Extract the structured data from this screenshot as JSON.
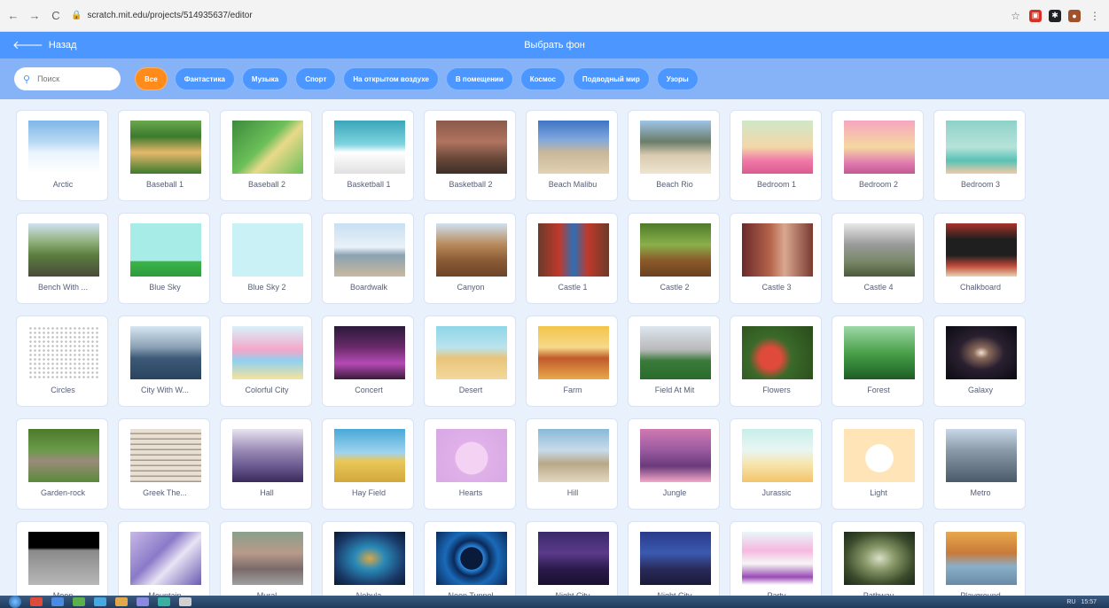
{
  "browser": {
    "url": "scratch.mit.edu/projects/514935637/editor",
    "back_glyph": "←",
    "forward_glyph": "→",
    "reload_glyph": "C",
    "star_glyph": "☆",
    "extensions": [
      {
        "name": "pdf-extension-icon",
        "color": "#d93025",
        "glyph": "▣"
      },
      {
        "name": "puzzle-extension-icon",
        "color": "#202124",
        "glyph": "✱"
      },
      {
        "name": "profile-avatar-icon",
        "color": "#a0522d",
        "glyph": "●"
      }
    ],
    "menu_glyph": "⋮"
  },
  "header": {
    "back_label": "Назад",
    "back_glyph": "🡐",
    "title": "Выбрать фон"
  },
  "filter": {
    "search_placeholder": "Поиск",
    "search_glyph": "⚲",
    "tags": [
      "Все",
      "Фантастика",
      "Музыка",
      "Спорт",
      "На открытом воздухе",
      "В помещении",
      "Космос",
      "Подводный мир",
      "Узоры"
    ],
    "active_tag": 0
  },
  "colors": {
    "accent": "#4c97ff",
    "active_tag": "#ff8c1a",
    "filter_bar": "#86b3f7"
  },
  "backdrops": [
    {
      "label": "Arctic",
      "bg": "linear-gradient(#7fb6e8 0%, #b7d9f3 40%, #e9f4fb 60%, #ffffff 100%)"
    },
    {
      "label": "Baseball 1",
      "bg": "linear-gradient(#6aa84f 0%, #3c7a2d 30%, #e6b86a 60%, #3c7a2d 100%)"
    },
    {
      "label": "Baseball 2",
      "bg": "linear-gradient(135deg, #3c8a3c 0%, #6cbf5a 45%, #e9d98a 60%, #6cbf5a 100%)"
    },
    {
      "label": "Basketball 1",
      "bg": "linear-gradient(#3aa6b9 0%, #7fd4e0 45%, #ffffff 60%, #e0e0e0 100%)"
    },
    {
      "label": "Basketball 2",
      "bg": "linear-gradient(#8b5a4a 0%, #b07360 40%, #6b4a3a 70%, #3d2f28 100%)"
    },
    {
      "label": "Beach Malibu",
      "bg": "linear-gradient(#3f73c4 0%, #7fa7de 35%, #c9b79a 60%, #e2d2b4 100%)"
    },
    {
      "label": "Beach Rio",
      "bg": "linear-gradient(#9ec4e8 0%, #6a7d6a 40%, #d9cbb0 65%, #efe4cf 100%)"
    },
    {
      "label": "Bedroom 1",
      "bg": "linear-gradient(#cfe8c8 0%, #f3d7a8 50%, #f07aa8 75%, #d95c8e 100%)"
    },
    {
      "label": "Bedroom 2",
      "bg": "linear-gradient(#f6a6c0 0%, #f5d8a0 50%, #e07ab0 80%, #c05a90 100%)"
    },
    {
      "label": "Bedroom 3",
      "bg": "linear-gradient(#8fd1c7 0%, #b6e3da 50%, #57c2b4 75%, #f3c9a8 100%)"
    },
    {
      "label": "Bench With ...",
      "bg": "linear-gradient(#d0e1f2 0%, #8fb07a 35%, #5b7d3e 60%, #4a4a3a 100%)"
    },
    {
      "label": "Blue Sky",
      "bg": "linear-gradient(#a8ece8 0%, #a8ece8 70%, #3bb54a 72%, #2e9a3c 100%)"
    },
    {
      "label": "Blue Sky 2",
      "bg": "linear-gradient(#c9f1f6 0%, #c9f1f6 100%)"
    },
    {
      "label": "Boardwalk",
      "bg": "linear-gradient(#c8dff3 0%, #e9f1f8 45%, #8ba2b2 60%, #c9b99f 100%)"
    },
    {
      "label": "Canyon",
      "bg": "linear-gradient(#cfe1f0 0%, #b8895a 40%, #8a5a34 70%, #6e4428 100%)"
    },
    {
      "label": "Castle 1",
      "bg": "linear-gradient(90deg, #6b3a2a 0%, #c0392b 30%, #2d6fb5 50%, #c0392b 70%, #6b3a2a 100%)"
    },
    {
      "label": "Castle 2",
      "bg": "linear-gradient(#4e7a2a 0%, #8ab04a 40%, #8a5a2a 70%, #6a4020 100%)"
    },
    {
      "label": "Castle 3",
      "bg": "linear-gradient(90deg, #6a2a2a 0%, #b5654a 40%, #d9a890 60%, #7a3a30 100%)"
    },
    {
      "label": "Castle 4",
      "bg": "linear-gradient(#e8e8e8 0%, #9a9a9a 40%, #7a8a6a 70%, #4a5a3a 100%)"
    },
    {
      "label": "Chalkboard",
      "bg": "linear-gradient(#a8322a 0%, #1f1f1f 30%, #1f1f1f 60%, #c04a3a 80%, #e9d4b0 100%)"
    },
    {
      "label": "Circles",
      "bg": "radial-gradient(circle, #bdbdbd 1px, #ffffff 1.5px) 0 0 / 5px 5px"
    },
    {
      "label": "City With W...",
      "bg": "linear-gradient(#d6e6f3 0%, #8aa0b3 40%, #3c5a78 60%, #2a4460 100%)"
    },
    {
      "label": "Colorful City",
      "bg": "linear-gradient(#d8f1fa 0%, #f3a6c8 45%, #8fd1f0 65%, #f6e39a 100%)"
    },
    {
      "label": "Concert",
      "bg": "linear-gradient(#2a1a3a 0%, #6a2a6a 40%, #b54ab5 70%, #3a1a3a 100%)"
    },
    {
      "label": "Desert",
      "bg": "linear-gradient(#8fd6e8 0%, #b9e4ee 40%, #e9c47a 60%, #f3d89a 100%)"
    },
    {
      "label": "Farm",
      "bg": "linear-gradient(#f3c44a 0%, #f6d98a 40%, #c05a2a 60%, #e9a84a 100%)"
    },
    {
      "label": "Field At Mit",
      "bg": "linear-gradient(#dde6ee 0%, #b8b8b8 45%, #3a7a3a 65%, #2a6a2a 100%)"
    },
    {
      "label": "Flowers",
      "bg": "radial-gradient(circle at 40% 60%, #e04a3a 0%, #e04a3a 20%, #3a6a2a 40%, #2a4a1a 100%)"
    },
    {
      "label": "Forest",
      "bg": "linear-gradient(#9fd8a8 0%, #4aa04a 50%, #2e7a34 80%, #1f5a24 100%)"
    },
    {
      "label": "Galaxy",
      "bg": "radial-gradient(ellipse at 50% 50%, #f0e0d0 0%, #8a6a5a 15%, #2a2030 45%, #0a0a12 100%)"
    },
    {
      "label": "Garden-rock",
      "bg": "linear-gradient(#4a7a2a 0%, #6a9a4a 40%, #9a8a7a 60%, #5a8a3a 100%)"
    },
    {
      "label": "Greek The...",
      "bg": "repeating-linear-gradient(#e9e0d4 0px, #e9e0d4 4px, #a89a88 5px, #a89a88 6px)"
    },
    {
      "label": "Hall",
      "bg": "linear-gradient(#e9e4f0 0%, #9a8ab5 40%, #6a5a90 70%, #3a2a5a 100%)"
    },
    {
      "label": "Hay Field",
      "bg": "linear-gradient(#4aa8d8 0%, #9fd4ee 45%, #e9c85a 60%, #d4a83a 100%)"
    },
    {
      "label": "Hearts",
      "bg": "radial-gradient(circle at 50% 55%, #f3d2f3 0%, #f3d2f3 35%, #e0b0e8 36%, #d8a8e6 100%)"
    },
    {
      "label": "Hill",
      "bg": "linear-gradient(#8ab8d8 0%, #c8dcea 40%, #b8a888 65%, #e4d8c0 100%)"
    },
    {
      "label": "Jungle",
      "bg": "linear-gradient(#d07ab0 0%, #9a5aa0 40%, #6a3a7a 70%, #f3a8c8 100%)"
    },
    {
      "label": "Jurassic",
      "bg": "linear-gradient(#c8eeea 0%, #e8f6f3 40%, #f6e6b0 65%, #f3c46a 100%)"
    },
    {
      "label": "Light",
      "bg": "radial-gradient(circle at 50% 55%, #ffffff 0%, #ffffff 30%, #ffe4b8 31%, #ffe4b8 100%)"
    },
    {
      "label": "Metro",
      "bg": "linear-gradient(#c8d8e8 0%, #8a9aa8 40%, #6a7a88 70%, #4a5a6a 100%)"
    },
    {
      "label": "Moon",
      "bg": "linear-gradient(#000000 0%, #000000 30%, #8a8a8a 35%, #b8b8b8 100%)"
    },
    {
      "label": "Mountain",
      "bg": "linear-gradient(135deg, #c8b8e8 0%, #8a7ac8 40%, #e8e4f4 60%, #6a5ab0 100%)"
    },
    {
      "label": "Mural",
      "bg": "linear-gradient(#8aa08a 0%, #b89a8a 40%, #7a6a6a 70%, #a0a0a0 100%)"
    },
    {
      "label": "Nebula",
      "bg": "radial-gradient(ellipse at 50% 50%, #d8a84a 0%, #2a8ab8 30%, #1a3a6a 70%, #0a1a30 100%)"
    },
    {
      "label": "Neon Tunnel",
      "bg": "radial-gradient(circle, #0a1a3a 0%, #0a1a3a 25%, #2a8ae0 26%, #0a2a5a 40%, #1a6ab8 60%, #0a2a5a 100%)"
    },
    {
      "label": "Night City",
      "bg": "linear-gradient(#3a2a6a 0%, #5a3a8a 40%, #2a1a4a 70%, #1a1030 100%)"
    },
    {
      "label": "Night City",
      "bg": "linear-gradient(#2a3a8a 0%, #3a5ab0 40%, #2a2a5a 70%, #1a1a3a 100%)"
    },
    {
      "label": "Party",
      "bg": "linear-gradient(#e8f6fa 0%, #f6b8e0 35%, #f6f6f6 60%, #9a4ab5 85%, #ffffff 100%)"
    },
    {
      "label": "Pathway",
      "bg": "radial-gradient(ellipse at 50% 50%, #d8e0c8 0%, #8a9a6a 30%, #3a4a2a 70%, #1a2a1a 100%)"
    },
    {
      "label": "Playground",
      "bg": "linear-gradient(#e8a84a 0%, #c87a3a 40%, #8ab0c8 65%, #6a8aa8 100%)"
    }
  ],
  "taskbar": {
    "icons": [
      "#e04a3a",
      "#4a8ae0",
      "#5ab04a",
      "#4aa8e0",
      "#e0a84a",
      "#8a8ae0",
      "#3ab0a0",
      "#d0d0d0"
    ],
    "tray_language": "RU",
    "tray_time": "15:57"
  }
}
